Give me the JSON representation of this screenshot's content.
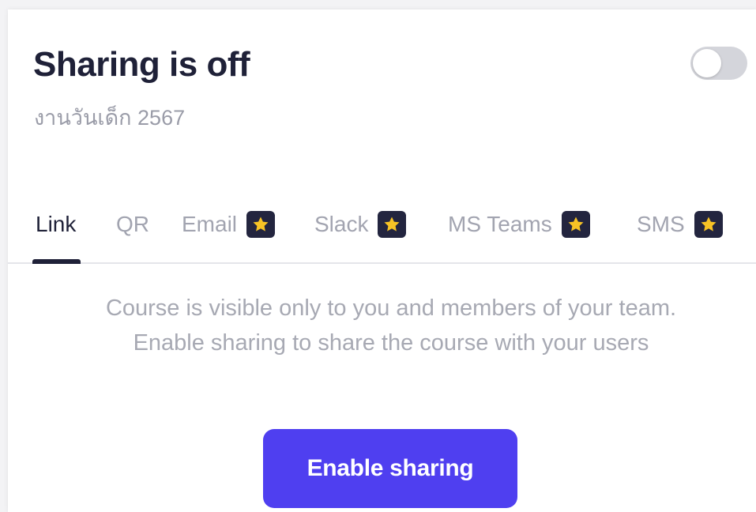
{
  "header": {
    "title": "Sharing is off",
    "subtitle": "งานวันเด็ก 2567",
    "sharing_enabled": false
  },
  "tabs": [
    {
      "label": "Link",
      "active": true,
      "premium": false
    },
    {
      "label": "QR",
      "active": false,
      "premium": false
    },
    {
      "label": "Email",
      "active": false,
      "premium": true,
      "icon": "star-icon"
    },
    {
      "label": "Slack",
      "active": false,
      "premium": true,
      "icon": "star-icon"
    },
    {
      "label": "MS Teams",
      "active": false,
      "premium": true,
      "icon": "star-icon"
    },
    {
      "label": "SMS",
      "active": false,
      "premium": true,
      "icon": "star-icon"
    }
  ],
  "content": {
    "message": "Course is visible only to you and members of your team. Enable sharing to share the course with your users",
    "enable_button_label": "Enable sharing"
  },
  "colors": {
    "accent": "#4f3ff0",
    "title": "#1f2138",
    "star_badge": "#23253f",
    "star": "#f7c325",
    "toggle_off": "#d4d5db"
  }
}
